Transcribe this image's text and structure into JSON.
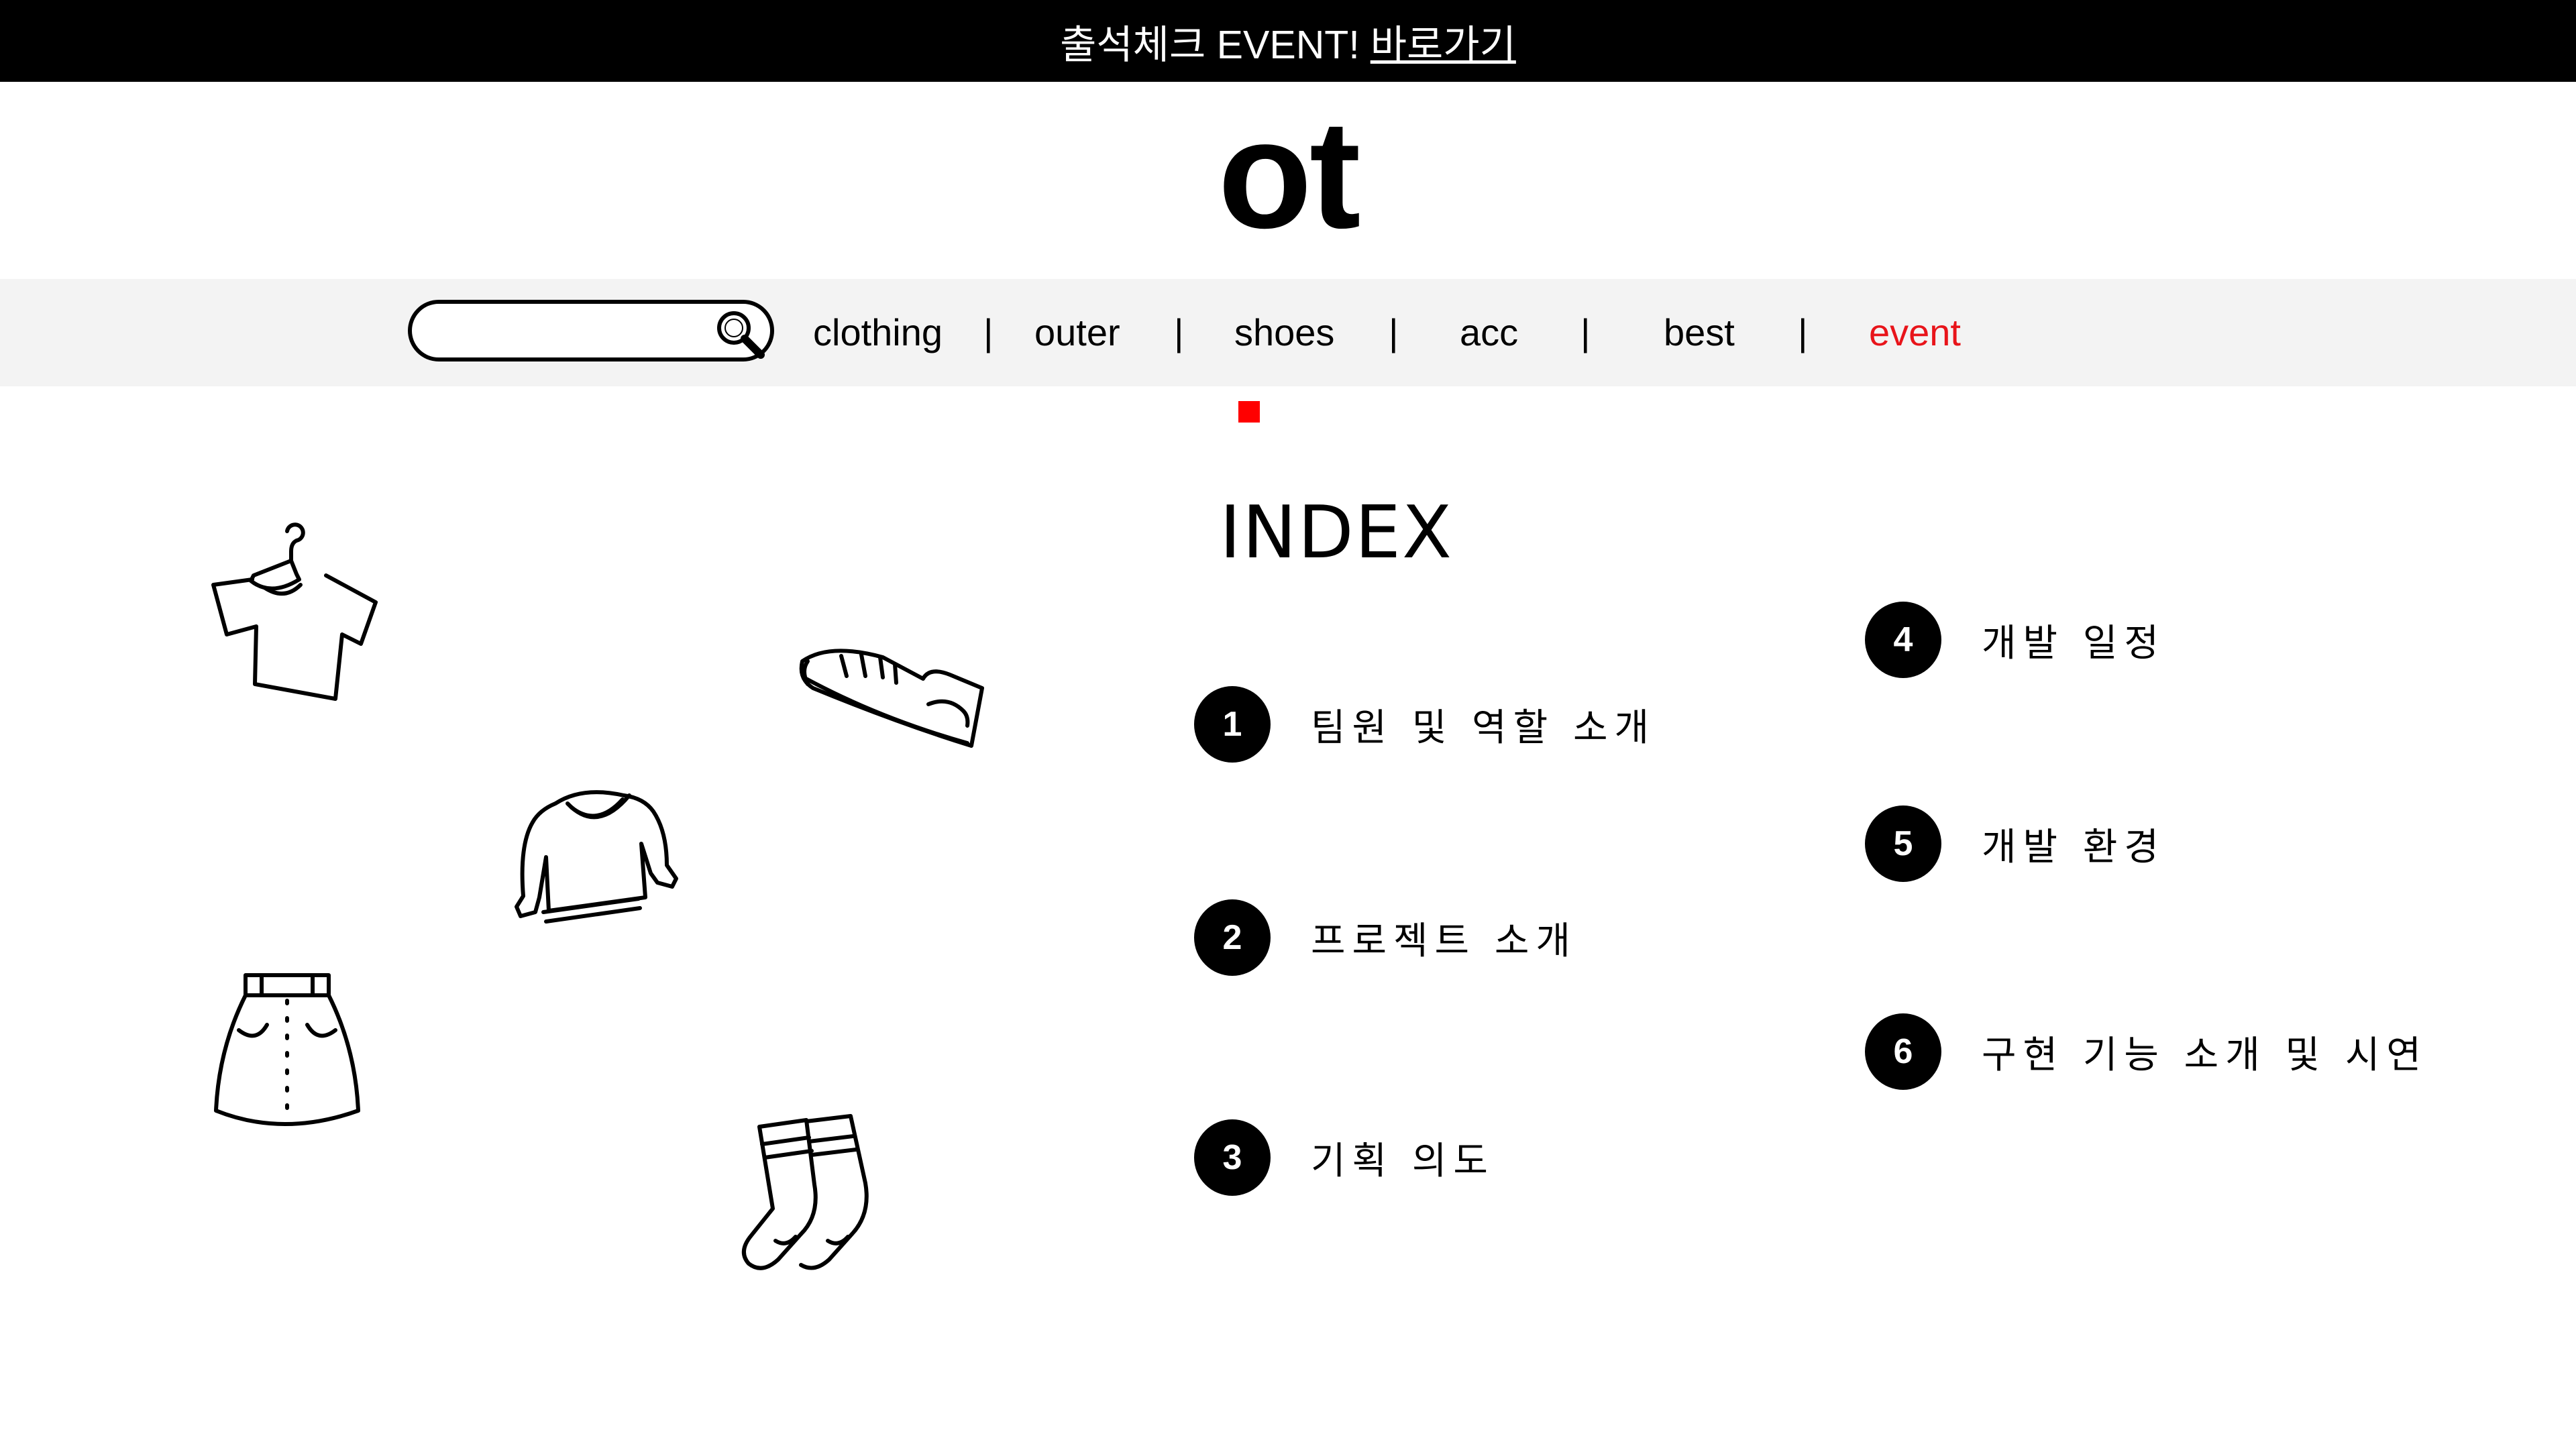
{
  "announcement": {
    "text": "출석체크 EVENT!",
    "link": "바로가기"
  },
  "logo": "ot",
  "search": {
    "value": "",
    "placeholder": ""
  },
  "nav": {
    "items": [
      "clothing",
      "outer",
      "shoes",
      "acc",
      "best",
      "event"
    ],
    "separator": "|",
    "active_color": "#e8141a"
  },
  "index": {
    "title": "INDEX",
    "items": [
      {
        "num": "1",
        "label": "팀원 및 역할 소개"
      },
      {
        "num": "2",
        "label": "프로젝트 소개"
      },
      {
        "num": "3",
        "label": "기획 의도"
      },
      {
        "num": "4",
        "label": "개발 일정"
      },
      {
        "num": "5",
        "label": "개발 환경"
      },
      {
        "num": "6",
        "label": "구현 기능 소개 및 시연"
      }
    ]
  },
  "icons": [
    "tshirt-hanger-icon",
    "sneaker-icon",
    "sweatshirt-icon",
    "skirt-icon",
    "socks-icon",
    "search-icon"
  ]
}
